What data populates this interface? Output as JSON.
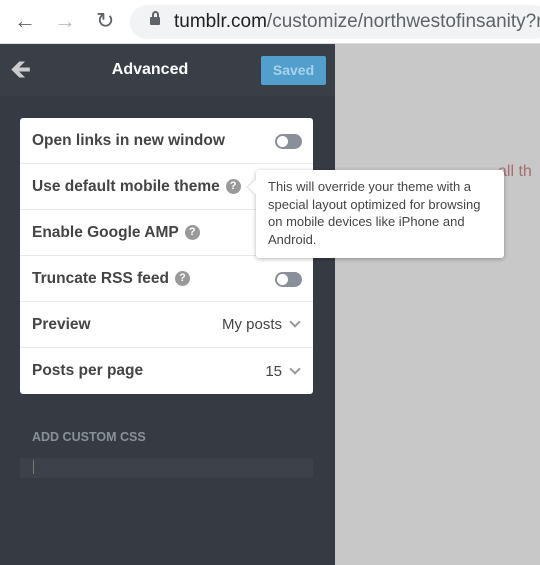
{
  "browser": {
    "url_host": "tumblr.com",
    "url_path": "/customize/northwestofinsanity?red"
  },
  "header": {
    "title": "Advanced",
    "saved_label": "Saved",
    "saved_color": "#529ecc"
  },
  "settings": [
    {
      "label": "Open links in new window",
      "toggle": false
    },
    {
      "label": "Use default mobile theme",
      "help": true
    },
    {
      "label": "Enable Google AMP",
      "help": true
    },
    {
      "label": "Truncate RSS feed",
      "help": true,
      "toggle": false
    },
    {
      "label": "Preview",
      "value": "My posts"
    },
    {
      "label": "Posts per page",
      "value": "15"
    }
  ],
  "custom_css": {
    "label": "ADD CUSTOM CSS",
    "value": ""
  },
  "tooltip": "This will override your theme with a special layout optimized for browsing on mobile devices like iPhone and Android.",
  "preview_text": "all th"
}
